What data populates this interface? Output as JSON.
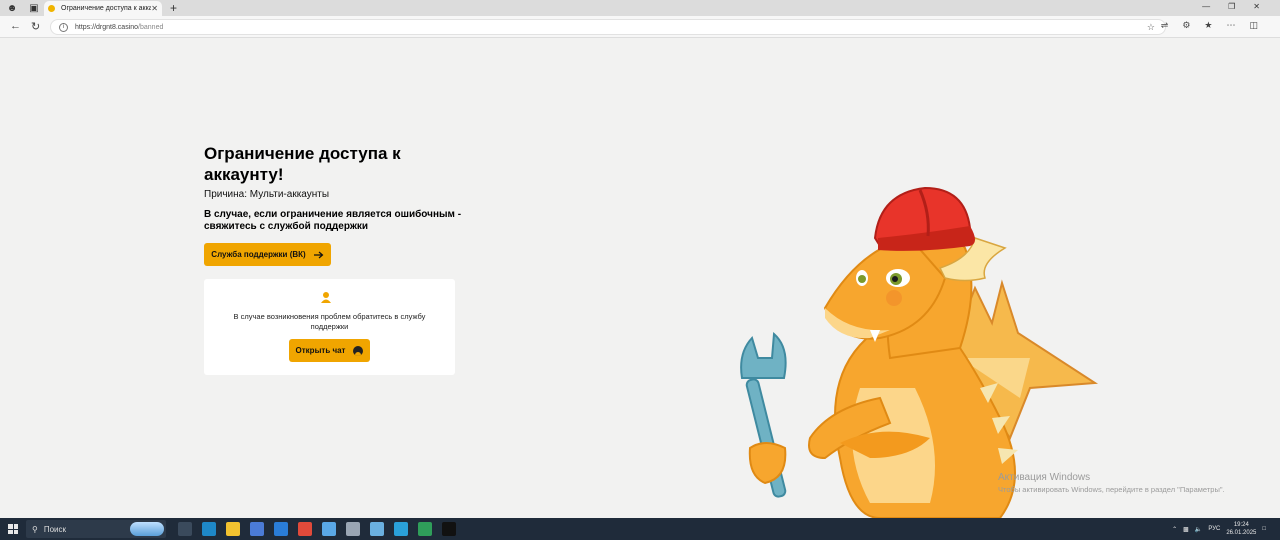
{
  "browser": {
    "tab_title": "Ограничение доступа к аккаунту!",
    "url_host": "https://drgnt8.casino",
    "url_path": "/banned"
  },
  "page": {
    "title": "Ограничение доступа к аккаунту!",
    "reason": "Причина: Мульти-аккаунты",
    "notice": "В случае, если ограничение является ошибочным - свяжитесь с службой поддержки",
    "support_button": "Служба поддержки (ВК)",
    "card_text": "В случае возникновения проблем обратитесь в службу поддержки",
    "chat_button": "Открыть чат"
  },
  "watermark": {
    "line1": "Активация Windows",
    "line2": "Чтобы активировать Windows, перейдите в раздел \"Параметры\"."
  },
  "taskbar": {
    "search_label": "Поиск",
    "language": "РУС",
    "time": "19:24",
    "date": "26.01.2025"
  },
  "colors": {
    "accent": "#f0a500",
    "background": "#f2f2f1",
    "taskbar": "#1f2b3a"
  }
}
